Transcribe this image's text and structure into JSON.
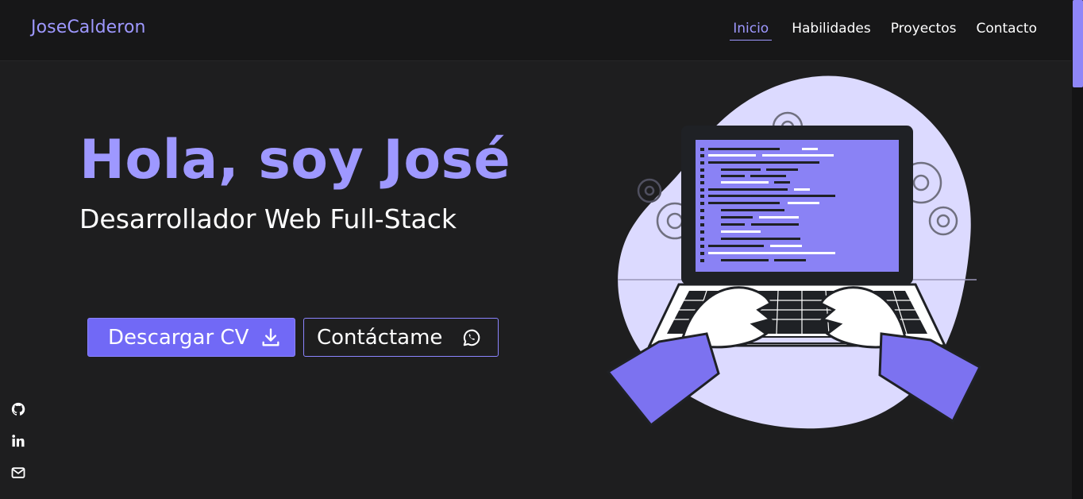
{
  "brand": "JoseCalderon",
  "nav": {
    "items": [
      "Inicio",
      "Habilidades",
      "Proyectos",
      "Contacto"
    ],
    "active": "Inicio"
  },
  "hero": {
    "title": "Hola, soy José",
    "subtitle": "Desarrollador Web Full-Stack"
  },
  "buttons": {
    "download_cv": {
      "label": "Descargar CV",
      "icon": "download-icon"
    },
    "contact": {
      "label": "Contáctame",
      "icon": "whatsapp-icon"
    }
  },
  "social": [
    {
      "name": "github-icon"
    },
    {
      "name": "linkedin-icon"
    },
    {
      "name": "mail-icon"
    }
  ],
  "colors": {
    "accent": "#9e98ff",
    "button": "#7169f6",
    "background": "#1e1e1f",
    "navbar": "#171718"
  }
}
